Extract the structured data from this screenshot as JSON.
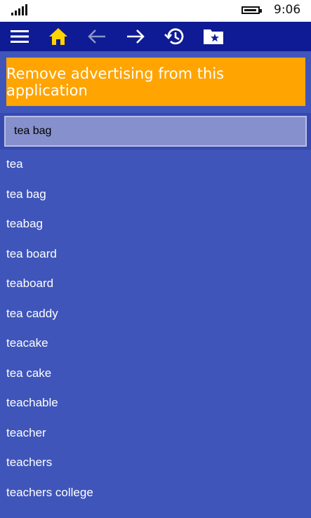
{
  "status_bar": {
    "time": "9:06"
  },
  "toolbar": {
    "icons": [
      "menu-icon",
      "home-icon",
      "back-arrow-icon",
      "forward-arrow-icon",
      "history-icon",
      "favorites-folder-icon"
    ],
    "home_color": "#ffd400",
    "active_color": "#ffffff",
    "disabled_color": "#8a93c8"
  },
  "ad_banner": {
    "text": "Remove advertising from this application",
    "background": "#ffa400"
  },
  "search": {
    "value": "tea bag"
  },
  "suggestions": [
    "tea",
    "tea bag",
    "teabag",
    "tea board",
    "teaboard",
    "tea caddy",
    "teacake",
    "tea cake",
    "teachable",
    "teacher",
    "teachers",
    "teachers college"
  ],
  "colors": {
    "list_background": "#3f55b9",
    "toolbar_background": "#0e1b94"
  }
}
